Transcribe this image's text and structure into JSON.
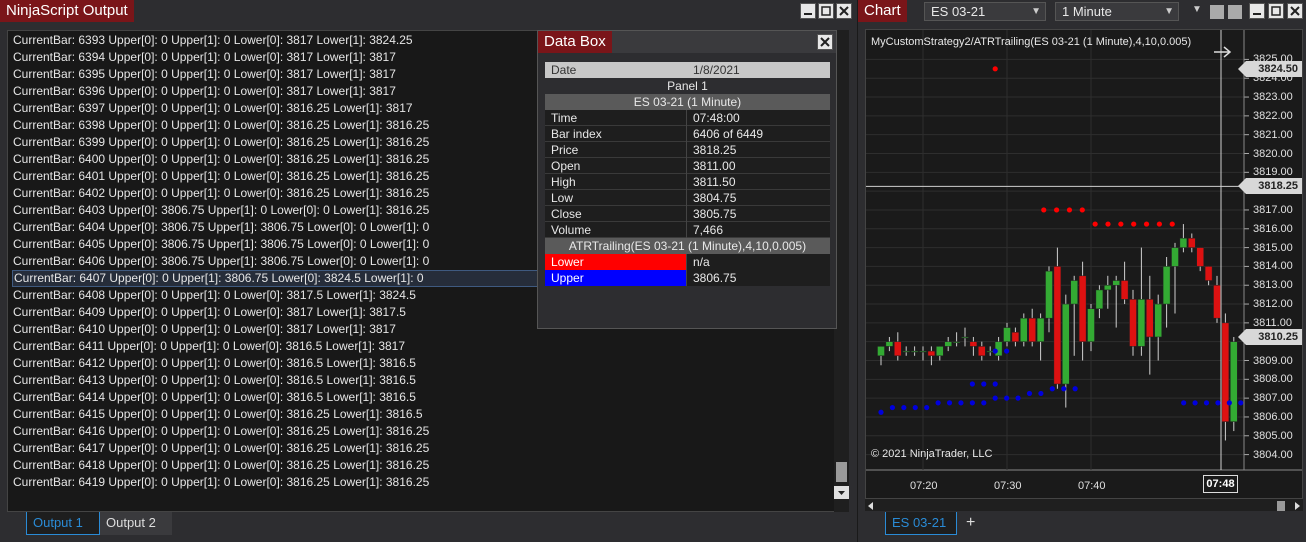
{
  "output": {
    "title": "NinjaScript Output",
    "lines": [
      "CurrentBar: 6393 Upper[0]: 0 Upper[1]: 0 Lower[0]: 3817 Lower[1]: 3824.25",
      "CurrentBar: 6394 Upper[0]: 0 Upper[1]: 0 Lower[0]: 3817 Lower[1]: 3817",
      "CurrentBar: 6395 Upper[0]: 0 Upper[1]: 0 Lower[0]: 3817 Lower[1]: 3817",
      "CurrentBar: 6396 Upper[0]: 0 Upper[1]: 0 Lower[0]: 3817 Lower[1]: 3817",
      "CurrentBar: 6397 Upper[0]: 0 Upper[1]: 0 Lower[0]: 3816.25 Lower[1]: 3817",
      "CurrentBar: 6398 Upper[0]: 0 Upper[1]: 0 Lower[0]: 3816.25 Lower[1]: 3816.25",
      "CurrentBar: 6399 Upper[0]: 0 Upper[1]: 0 Lower[0]: 3816.25 Lower[1]: 3816.25",
      "CurrentBar: 6400 Upper[0]: 0 Upper[1]: 0 Lower[0]: 3816.25 Lower[1]: 3816.25",
      "CurrentBar: 6401 Upper[0]: 0 Upper[1]: 0 Lower[0]: 3816.25 Lower[1]: 3816.25",
      "CurrentBar: 6402 Upper[0]: 0 Upper[1]: 0 Lower[0]: 3816.25 Lower[1]: 3816.25",
      "CurrentBar: 6403 Upper[0]: 3806.75 Upper[1]: 0 Lower[0]: 0 Lower[1]: 3816.25",
      "CurrentBar: 6404 Upper[0]: 3806.75 Upper[1]: 3806.75 Lower[0]: 0 Lower[1]: 0",
      "CurrentBar: 6405 Upper[0]: 3806.75 Upper[1]: 3806.75 Lower[0]: 0 Lower[1]: 0",
      "CurrentBar: 6406 Upper[0]: 3806.75 Upper[1]: 3806.75 Lower[0]: 0 Lower[1]: 0",
      "CurrentBar: 6407 Upper[0]: 0 Upper[1]: 3806.75 Lower[0]: 3824.5 Lower[1]: 0",
      "CurrentBar: 6408 Upper[0]: 0 Upper[1]: 0 Lower[0]: 3817.5 Lower[1]: 3824.5",
      "CurrentBar: 6409 Upper[0]: 0 Upper[1]: 0 Lower[0]: 3817 Lower[1]: 3817.5",
      "CurrentBar: 6410 Upper[0]: 0 Upper[1]: 0 Lower[0]: 3817 Lower[1]: 3817",
      "CurrentBar: 6411 Upper[0]: 0 Upper[1]: 0 Lower[0]: 3816.5 Lower[1]: 3817",
      "CurrentBar: 6412 Upper[0]: 0 Upper[1]: 0 Lower[0]: 3816.5 Lower[1]: 3816.5",
      "CurrentBar: 6413 Upper[0]: 0 Upper[1]: 0 Lower[0]: 3816.5 Lower[1]: 3816.5",
      "CurrentBar: 6414 Upper[0]: 0 Upper[1]: 0 Lower[0]: 3816.5 Lower[1]: 3816.5",
      "CurrentBar: 6415 Upper[0]: 0 Upper[1]: 0 Lower[0]: 3816.25 Lower[1]: 3816.5",
      "CurrentBar: 6416 Upper[0]: 0 Upper[1]: 0 Lower[0]: 3816.25 Lower[1]: 3816.25",
      "CurrentBar: 6417 Upper[0]: 0 Upper[1]: 0 Lower[0]: 3816.25 Lower[1]: 3816.25",
      "CurrentBar: 6418 Upper[0]: 0 Upper[1]: 0 Lower[0]: 3816.25 Lower[1]: 3816.25",
      "CurrentBar: 6419 Upper[0]: 0 Upper[1]: 0 Lower[0]: 3816.25 Lower[1]: 3816.25"
    ],
    "selected_index": 14,
    "tabs": [
      "Output 1",
      "Output 2"
    ],
    "active_tab": 0
  },
  "databox": {
    "title": "Data Box",
    "date_label": "Date",
    "date_value": "1/8/2021",
    "panel": "Panel 1",
    "instrument_header": "ES 03-21 (1 Minute)",
    "fields": [
      {
        "label": "Time",
        "value": "07:48:00"
      },
      {
        "label": "Bar index",
        "value": "6406 of 6449"
      },
      {
        "label": "Price",
        "value": "3818.25"
      },
      {
        "label": "Open",
        "value": "3811.00"
      },
      {
        "label": "High",
        "value": "3811.50"
      },
      {
        "label": "Low",
        "value": "3804.75"
      },
      {
        "label": "Close",
        "value": "3805.75"
      },
      {
        "label": "Volume",
        "value": "7,466"
      }
    ],
    "indicator_header": "ATRTrailing(ES 03-21 (1 Minute),4,10,0.005)",
    "plots": [
      {
        "label": "Lower",
        "value": "n/a",
        "color": "#ff0000"
      },
      {
        "label": "Upper",
        "value": "3806.75",
        "color": "#0000ff"
      }
    ]
  },
  "chart": {
    "title": "Chart",
    "instrument": "ES 03-21",
    "interval": "1 Minute",
    "strategy_label": "MyCustomStrategy2/ATRTrailing(ES 03-21 (1 Minute),4,10,0.005)",
    "copyright": "© 2021 NinjaTrader, LLC",
    "tab": "ES 03-21",
    "add_tab": "+",
    "price_tags": [
      {
        "price": 3824.5,
        "text": "3824.50"
      },
      {
        "price": 3818.25,
        "text": "3818.25"
      },
      {
        "price": 3810.25,
        "text": "3810.25"
      }
    ],
    "time_labels": [
      "07:20",
      "07:30",
      "07:40"
    ],
    "cursor_time": "07:48",
    "colors": {
      "up": "#33aa33",
      "down": "#dd1111",
      "lower": "#ff0000",
      "upper": "#0000dd",
      "accent": "#7a1519"
    }
  },
  "chart_data": {
    "type": "candlestick",
    "y_ticks": [
      "3825.00",
      "3824.00",
      "3823.00",
      "3822.00",
      "3821.00",
      "3820.00",
      "3819.00",
      "3818.00",
      "3817.00",
      "3816.00",
      "3815.00",
      "3814.00",
      "3813.00",
      "3812.00",
      "3811.00",
      "3810.00",
      "3809.00",
      "3808.00",
      "3807.00",
      "3806.00",
      "3805.00",
      "3804.00"
    ],
    "ylim": [
      3803.5,
      3825.5
    ],
    "x_start_minute": 7.25,
    "x_minutes_per_bar": 1,
    "candles": [
      [
        3809.25,
        3809.75,
        3808.75,
        3809.75
      ],
      [
        3809.75,
        3810.25,
        3809.5,
        3810
      ],
      [
        3810,
        3810.5,
        3809,
        3809.25
      ],
      [
        3809.5,
        3809.75,
        3809.25,
        3809.5
      ],
      [
        3809.5,
        3809.75,
        3809.25,
        3809.5
      ],
      [
        3809.5,
        3809.75,
        3809,
        3809.5
      ],
      [
        3809.5,
        3809.75,
        3808.75,
        3809.25
      ],
      [
        3809.25,
        3809.75,
        3809,
        3809.75
      ],
      [
        3809.75,
        3810.25,
        3809.5,
        3810
      ],
      [
        3810,
        3810.5,
        3809.75,
        3810
      ],
      [
        3810.25,
        3810.75,
        3809.75,
        3810.25
      ],
      [
        3810,
        3810.25,
        3809.25,
        3809.75
      ],
      [
        3809.75,
        3810,
        3809,
        3809.25
      ],
      [
        3809.5,
        3809.75,
        3809.25,
        3809.5
      ],
      [
        3809.25,
        3810.25,
        3809,
        3810
      ],
      [
        3810,
        3811,
        3809.75,
        3810.75
      ],
      [
        3810.5,
        3810.75,
        3809.75,
        3810
      ],
      [
        3810,
        3811.5,
        3809.75,
        3811.25
      ],
      [
        3811.25,
        3811.75,
        3809.75,
        3810
      ],
      [
        3810,
        3811.5,
        3809,
        3811.25
      ],
      [
        3811.25,
        3814,
        3810.5,
        3813.75
      ],
      [
        3814,
        3815,
        3807.5,
        3807.75
      ],
      [
        3807.75,
        3812.5,
        3806.5,
        3812
      ],
      [
        3812,
        3813.5,
        3809.25,
        3813.25
      ],
      [
        3813.5,
        3814.25,
        3809,
        3810
      ],
      [
        3810,
        3812,
        3809.5,
        3811.75
      ],
      [
        3811.75,
        3813,
        3811.25,
        3812.75
      ],
      [
        3812.75,
        3813.5,
        3811.75,
        3813
      ],
      [
        3813,
        3813.5,
        3810.75,
        3813.25
      ],
      [
        3813.25,
        3814.25,
        3812,
        3812.25
      ],
      [
        3812.25,
        3812.75,
        3809.25,
        3809.75
      ],
      [
        3809.75,
        3815,
        3809.25,
        3812.25
      ],
      [
        3812.25,
        3813.5,
        3808.25,
        3810.25
      ],
      [
        3810.25,
        3812.5,
        3809,
        3812
      ],
      [
        3812,
        3814.5,
        3810.75,
        3814
      ],
      [
        3814,
        3815.25,
        3811.5,
        3815
      ],
      [
        3815,
        3816.25,
        3814.75,
        3815.5
      ],
      [
        3815.5,
        3815.75,
        3814.75,
        3815
      ],
      [
        3815,
        3815,
        3813.75,
        3814
      ],
      [
        3814,
        3814,
        3813,
        3813.25
      ],
      [
        3813,
        3813.5,
        3811,
        3811.25
      ],
      [
        3811,
        3811.5,
        3804.75,
        3805.75
      ],
      [
        3805.75,
        3810.25,
        3805.25,
        3810
      ]
    ],
    "lower_dots": [
      [
        7.33,
        3824.5
      ],
      [
        7.364,
        3817
      ],
      [
        7.373,
        3817
      ],
      [
        7.382,
        3817
      ],
      [
        7.391,
        3817
      ],
      [
        7.4,
        3816.25
      ],
      [
        7.409,
        3816.25
      ],
      [
        7.418,
        3816.25
      ],
      [
        7.427,
        3816.25
      ],
      [
        7.436,
        3816.25
      ],
      [
        7.445,
        3816.25
      ],
      [
        7.454,
        3816.25
      ]
    ],
    "upper_dots": [
      [
        7.25,
        3806.25
      ],
      [
        7.258,
        3806.5
      ],
      [
        7.266,
        3806.5
      ],
      [
        7.274,
        3806.5
      ],
      [
        7.282,
        3806.5
      ],
      [
        7.29,
        3806.75
      ],
      [
        7.298,
        3806.75
      ],
      [
        7.306,
        3806.75
      ],
      [
        7.314,
        3806.75
      ],
      [
        7.322,
        3806.75
      ],
      [
        7.33,
        3807
      ],
      [
        7.338,
        3807
      ],
      [
        7.346,
        3807
      ],
      [
        7.354,
        3807.25
      ],
      [
        7.362,
        3807.25
      ],
      [
        7.37,
        3807.5
      ],
      [
        7.378,
        3807.5
      ],
      [
        7.386,
        3807.5
      ],
      [
        7.314,
        3807.75
      ],
      [
        7.322,
        3807.75
      ],
      [
        7.33,
        3807.75
      ],
      [
        7.33,
        3809.5
      ],
      [
        7.338,
        3809.5
      ],
      [
        7.462,
        3806.75
      ],
      [
        7.47,
        3806.75
      ],
      [
        7.478,
        3806.75
      ],
      [
        7.486,
        3806.75
      ],
      [
        7.494,
        3806.75
      ],
      [
        7.502,
        3806.75
      ]
    ],
    "crosshair_price": 3818.25
  }
}
